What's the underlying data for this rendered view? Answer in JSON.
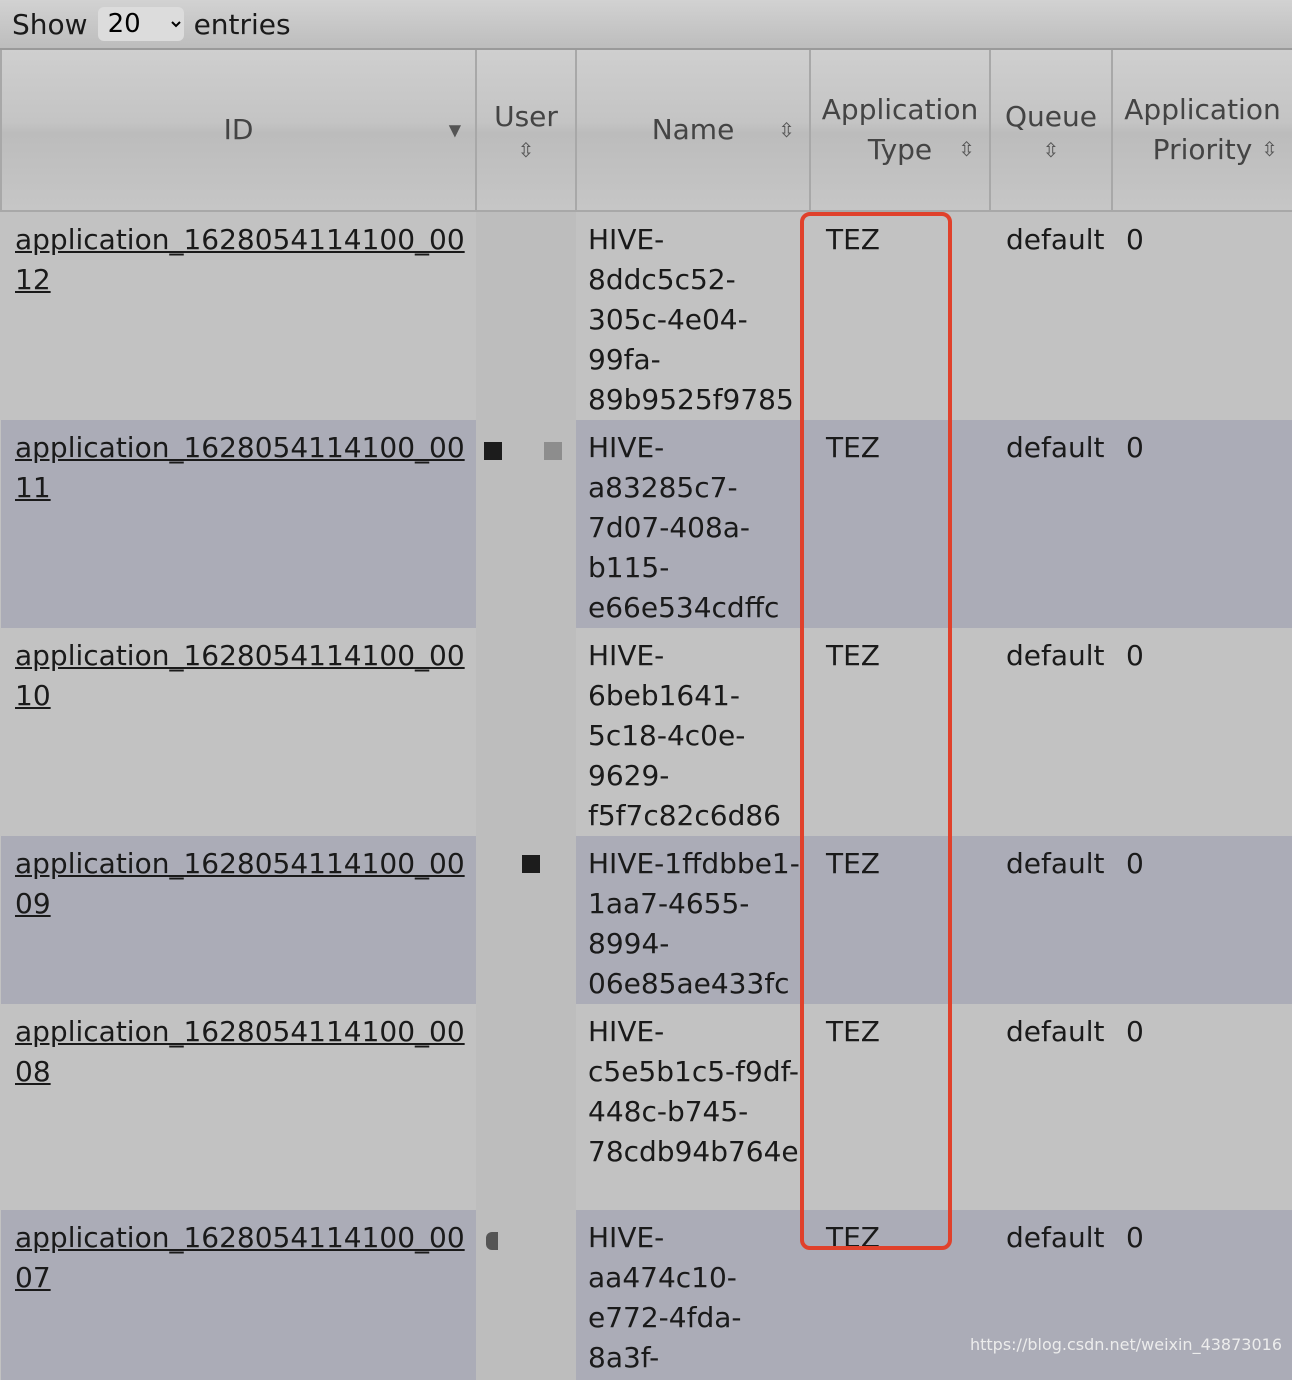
{
  "length_menu": {
    "prefix": "Show",
    "value": "20",
    "suffix": "entries"
  },
  "columns": [
    {
      "lines": [
        "ID"
      ]
    },
    {
      "lines": [
        "User"
      ]
    },
    {
      "lines": [
        "Name"
      ]
    },
    {
      "lines": [
        "Application",
        "Type"
      ]
    },
    {
      "lines": [
        "Queue"
      ]
    },
    {
      "lines": [
        "Application",
        "Priority"
      ]
    }
  ],
  "rows": [
    {
      "id": "application_1628054114100_0012",
      "user": "",
      "name": "HIVE-8ddc5c52-305c-4e04-99fa-89b9525f9785",
      "type": "TEZ",
      "queue": "default",
      "priority": "0"
    },
    {
      "id": "application_1628054114100_0011",
      "user": "",
      "name": "HIVE-a83285c7-7d07-408a-b115-e66e534cdffc",
      "type": "TEZ",
      "queue": "default",
      "priority": "0"
    },
    {
      "id": "application_1628054114100_0010",
      "user": "",
      "name": "HIVE-6beb1641-5c18-4c0e-9629-f5f7c82c6d86",
      "type": "TEZ",
      "queue": "default",
      "priority": "0"
    },
    {
      "id": "application_1628054114100_0009",
      "user": "",
      "name": "HIVE-1ffdbbe1-1aa7-4655-8994-06e85ae433fc",
      "type": "TEZ",
      "queue": "default",
      "priority": "0"
    },
    {
      "id": "application_1628054114100_0008",
      "user": "",
      "name": "HIVE-c5e5b1c5-f9df-448c-b745-78cdb94b764e",
      "type": "TEZ",
      "queue": "default",
      "priority": "0"
    },
    {
      "id": "application_1628054114100_0007",
      "user": "",
      "name": "HIVE-aa474c10-e772-4fda-8a3f-",
      "type": "TEZ",
      "queue": "default",
      "priority": "0"
    }
  ],
  "sort_icons": {
    "id": "caret-down-icon",
    "other": "sort-updown-icon"
  },
  "highlight_color": "#e0412b",
  "watermark": "https://blog.csdn.net/weixin_43873016"
}
